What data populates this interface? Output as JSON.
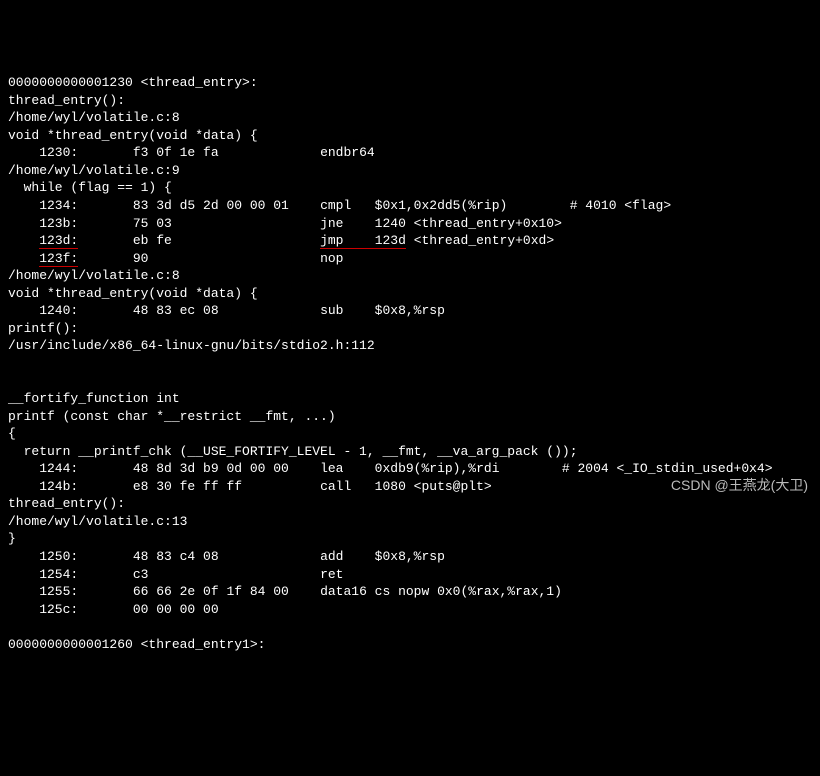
{
  "lines": {
    "l0": "0000000000001230 <thread_entry>:",
    "l1": "thread_entry():",
    "l2": "/home/wyl/volatile.c:8",
    "l3": "void *thread_entry(void *data) {",
    "l4_addr": "    1230:",
    "l4_hex": "       f3 0f 1e fa             ",
    "l4_inst": "endbr64",
    "l5": "/home/wyl/volatile.c:9",
    "l6": "  while (flag == 1) {",
    "l7_addr": "    1234:",
    "l7_hex": "       83 3d d5 2d 00 00 01    ",
    "l7_inst": "cmpl   $0x1,0x2dd5(%rip)        # 4010 <flag>",
    "l8_addr": "    123b:",
    "l8_hex": "       75 03                   ",
    "l8_inst": "jne    1240 <thread_entry+0x10>",
    "l9_pre": "    ",
    "l9_addr": "123d:",
    "l9_hex": "       eb fe                   ",
    "l9_inst1": "jmp    ",
    "l9_inst2": "123d",
    "l9_inst3": " <thread_entry+0xd>",
    "l10_pre": "    ",
    "l10_addr": "123f:",
    "l10_hex": "       90                      ",
    "l10_inst": "nop",
    "l11": "/home/wyl/volatile.c:8",
    "l12": "void *thread_entry(void *data) {",
    "l13_addr": "    1240:",
    "l13_hex": "       48 83 ec 08             ",
    "l13_inst": "sub    $0x8,%rsp",
    "l14": "printf():",
    "l15": "/usr/include/x86_64-linux-gnu/bits/stdio2.h:112",
    "l16": "",
    "l17": "",
    "l18": "__fortify_function int",
    "l19": "printf (const char *__restrict __fmt, ...)",
    "l20": "{",
    "l21": "  return __printf_chk (__USE_FORTIFY_LEVEL - 1, __fmt, __va_arg_pack ());",
    "l22_addr": "    1244:",
    "l22_hex": "       48 8d 3d b9 0d 00 00    ",
    "l22_inst": "lea    0xdb9(%rip),%rdi        # 2004 <_IO_stdin_used+0x4>",
    "l23_addr": "    124b:",
    "l23_hex": "       e8 30 fe ff ff          ",
    "l23_inst": "call   1080 <puts@plt>",
    "l24": "thread_entry():",
    "l25": "/home/wyl/volatile.c:13",
    "l26": "}",
    "l27_addr": "    1250:",
    "l27_hex": "       48 83 c4 08             ",
    "l27_inst": "add    $0x8,%rsp",
    "l28_addr": "    1254:",
    "l28_hex": "       c3                      ",
    "l28_inst": "ret",
    "l29_addr": "    1255:",
    "l29_hex": "       66 66 2e 0f 1f 84 00    ",
    "l29_inst": "data16 cs nopw 0x0(%rax,%rax,1)",
    "l30_addr": "    125c:",
    "l30_hex": "       00 00 00 00",
    "l31": "",
    "l32": "0000000000001260 <thread_entry1>:"
  },
  "watermark": "CSDN @王燕龙(大卫)"
}
